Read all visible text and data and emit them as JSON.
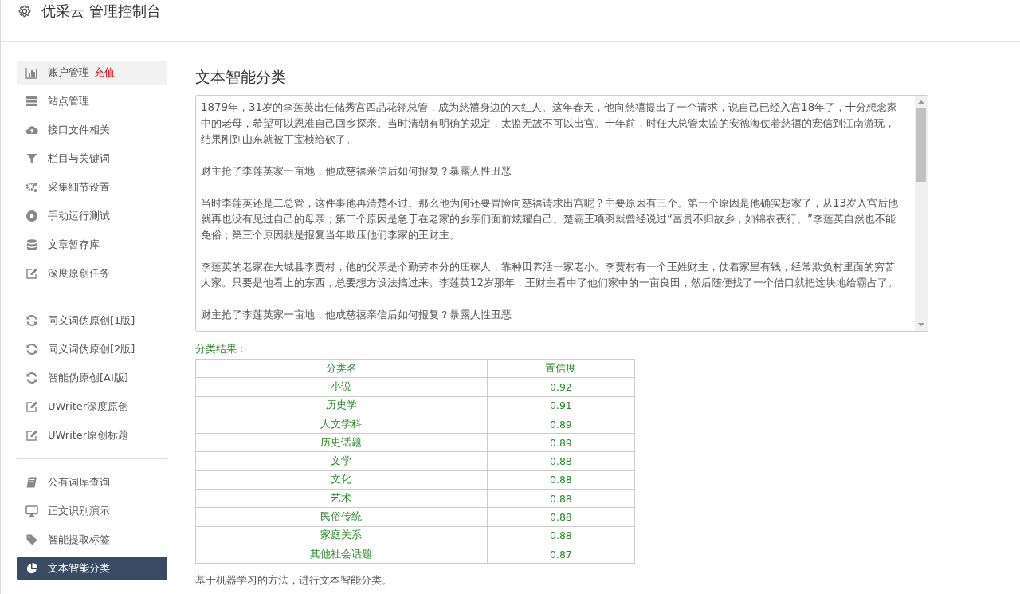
{
  "header": {
    "title": "优采云 管理控制台"
  },
  "sidebar": {
    "groups": [
      {
        "items": [
          {
            "label": "账户管理",
            "badge": "充值",
            "highlighted": true,
            "selected": false
          },
          {
            "label": "站点管理",
            "highlighted": false,
            "selected": false
          },
          {
            "label": "接口文件相关",
            "highlighted": false,
            "selected": false
          },
          {
            "label": "栏目与关键词",
            "highlighted": false,
            "selected": false
          },
          {
            "label": "采集细节设置",
            "highlighted": false,
            "selected": false
          },
          {
            "label": "手动运行测试",
            "highlighted": false,
            "selected": false
          },
          {
            "label": "文章暂存库",
            "highlighted": false,
            "selected": false
          },
          {
            "label": "深度原创任务",
            "highlighted": false,
            "selected": false
          }
        ]
      },
      {
        "items": [
          {
            "label": "同义词伪原创[1版]",
            "highlighted": false,
            "selected": false
          },
          {
            "label": "同义词伪原创[2版]",
            "highlighted": false,
            "selected": false
          },
          {
            "label": "智能伪原创[AI版]",
            "highlighted": false,
            "selected": false
          },
          {
            "label": "UWriter深度原创",
            "highlighted": false,
            "selected": false
          },
          {
            "label": "UWriter原创标题",
            "highlighted": false,
            "selected": false
          }
        ]
      },
      {
        "items": [
          {
            "label": "公有词库查询",
            "highlighted": false,
            "selected": false
          },
          {
            "label": "正文识别演示",
            "highlighted": false,
            "selected": false
          },
          {
            "label": "智能提取标签",
            "highlighted": false,
            "selected": false
          },
          {
            "label": "文本智能分类",
            "highlighted": false,
            "selected": true
          }
        ]
      }
    ]
  },
  "main": {
    "title": "文本智能分类",
    "input_text": [
      "1879年，31岁的李莲英出任储秀宫四品花翎总管，成为慈禧身边的大红人。这年春天，他向慈禧提出了一个请求，说自己已经入宫18年了，十分想念家中的老母，希望可以恩准自己回乡探亲。当时清朝有明确的规定，太监无故不可以出宫。十年前，时任大总管太监的安德海仗着慈禧的宠信到江南游玩，结果刚到山东就被丁宝桢给砍了。",
      "财主抢了李莲英家一亩地，他成慈禧亲信后如何报复？暴露人性丑恶",
      "当时李莲英还是二总管，这件事他再清楚不过。那么他为何还要冒险向慈禧请求出宫呢？主要原因有三个。第一个原因是他确实想家了，从13岁入宫后他就再也没有见过自己的母亲；第二个原因是急于在老家的乡亲们面前炫耀自己。楚霸王项羽就曾经说过“富贵不归故乡，如锦衣夜行。”李莲英自然也不能免俗；第三个原因就是报复当年欺压他们李家的王财主。",
      "李莲英的老家在大城县李贾村，他的父亲是个勤劳本分的庄稼人，靠种田养活一家老小。李贾村有一个王姓财主，仗着家里有钱，经常欺负村里面的穷苦人家。只要是他看上的东西，总要想方设法搞过来。李莲英12岁那年，王财主看中了他们家中的一亩良田，然后随便找了一个借口就把这块地给霸占了。",
      "财主抢了李莲英家一亩地，他成慈禧亲信后如何报复？暴露人性丑恶"
    ],
    "result_label": "分类结果：",
    "table": {
      "columns": [
        "分类名",
        "置信度"
      ],
      "rows": [
        [
          "小说",
          "0.92"
        ],
        [
          "历史学",
          "0.91"
        ],
        [
          "人文学科",
          "0.89"
        ],
        [
          "历史话题",
          "0.89"
        ],
        [
          "文学",
          "0.88"
        ],
        [
          "文化",
          "0.88"
        ],
        [
          "艺术",
          "0.88"
        ],
        [
          "民俗传统",
          "0.88"
        ],
        [
          "家庭关系",
          "0.88"
        ],
        [
          "其他社会话题",
          "0.87"
        ]
      ]
    },
    "note": "基于机器学习的方法，进行文本智能分类。"
  }
}
